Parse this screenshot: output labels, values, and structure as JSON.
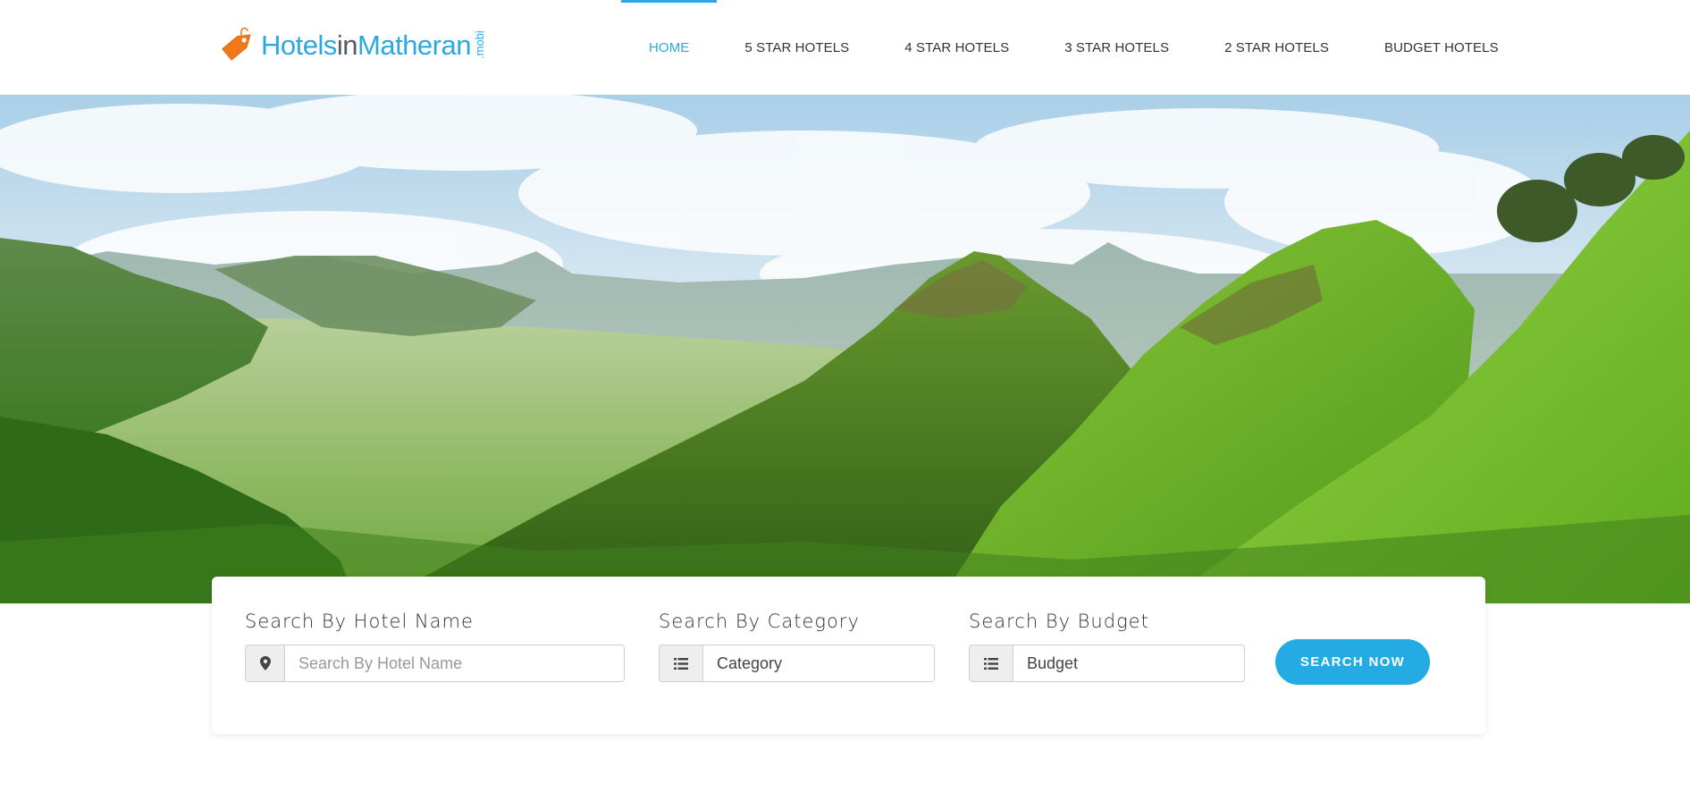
{
  "brand": {
    "logo_part1": "Hotels",
    "logo_part2": "in",
    "logo_part3": "Matheran",
    "logo_suffix": ".mobi",
    "accent_color": "#2aa8e0",
    "tag_color": "#f07a1a"
  },
  "nav": {
    "items": [
      {
        "label": "HOME",
        "active": true
      },
      {
        "label": "5 STAR HOTELS",
        "active": false
      },
      {
        "label": "4 STAR HOTELS",
        "active": false
      },
      {
        "label": "3 STAR HOTELS",
        "active": false
      },
      {
        "label": "2 STAR HOTELS",
        "active": false
      },
      {
        "label": "BUDGET HOTELS",
        "active": false
      }
    ]
  },
  "hero": {
    "image": "green mountain valley landscape"
  },
  "search": {
    "hotel_name": {
      "label": "Search By Hotel Name",
      "placeholder": "Search By Hotel Name",
      "icon": "map-marker-icon"
    },
    "category": {
      "label": "Search By Category",
      "value": "Category",
      "icon": "list-icon"
    },
    "budget": {
      "label": "Search By Budget",
      "value": "Budget",
      "icon": "list-icon"
    },
    "button_label": "SEARCH NOW",
    "button_color": "#24abe3"
  }
}
